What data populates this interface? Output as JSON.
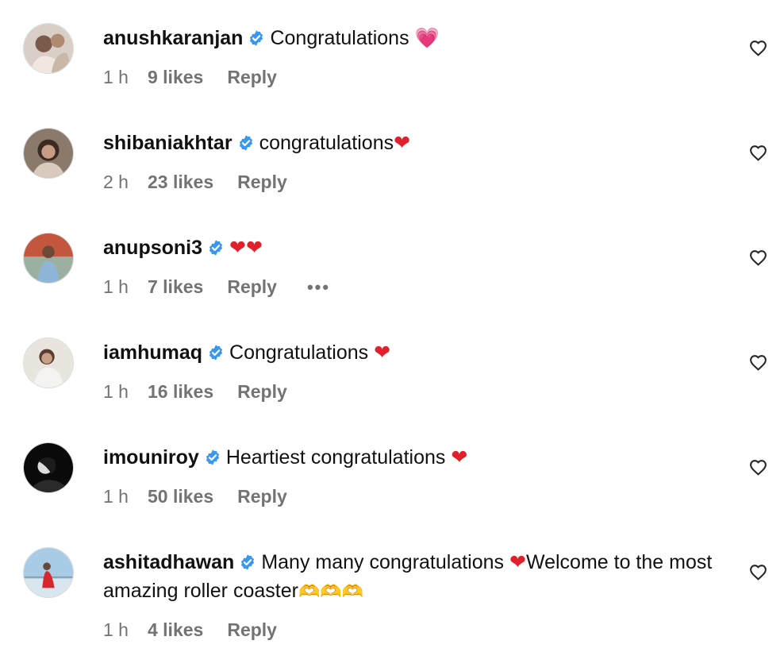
{
  "comments": [
    {
      "username": "anushkaranjan",
      "text": "Congratulations",
      "emoji": "💗",
      "emoji_kind": "pink-heart-icon",
      "time": "1 h",
      "likes": "9 likes",
      "reply": "Reply"
    },
    {
      "username": "shibaniakhtar",
      "text": "congratulations",
      "emoji": "❤",
      "emoji_kind": "red-heart-icon",
      "time": "2 h",
      "likes": "23 likes",
      "reply": "Reply"
    },
    {
      "username": "anupsoni3",
      "text": "",
      "emoji": "❤❤",
      "emoji_kind": "red-heart-icon",
      "time": "1 h",
      "likes": "7 likes",
      "reply": "Reply",
      "more": "•••"
    },
    {
      "username": "iamhumaq",
      "text": "Congratulations",
      "emoji": "❤",
      "emoji_kind": "red-heart-icon",
      "time": "1 h",
      "likes": "16 likes",
      "reply": "Reply"
    },
    {
      "username": "imouniroy",
      "text": "Heartiest congratulations",
      "emoji": "❤",
      "emoji_kind": "red-heart-icon",
      "time": "1 h",
      "likes": "50 likes",
      "reply": "Reply"
    },
    {
      "username": "ashitadhawan",
      "text": "Many many congratulations",
      "emoji": "❤",
      "emoji_kind": "red-heart-icon",
      "text2": "Welcome to the most amazing roller coaster",
      "emoji2": "🫶🫶🫶",
      "emoji2_kind": "heart-hands-icon",
      "time": "1 h",
      "likes": "4 likes",
      "reply": "Reply"
    }
  ],
  "colors": {
    "meta_text": "#737373",
    "verified_badge": "#3897f0",
    "red_heart": "#e0212b",
    "pink_heart": "#e93b9c"
  }
}
